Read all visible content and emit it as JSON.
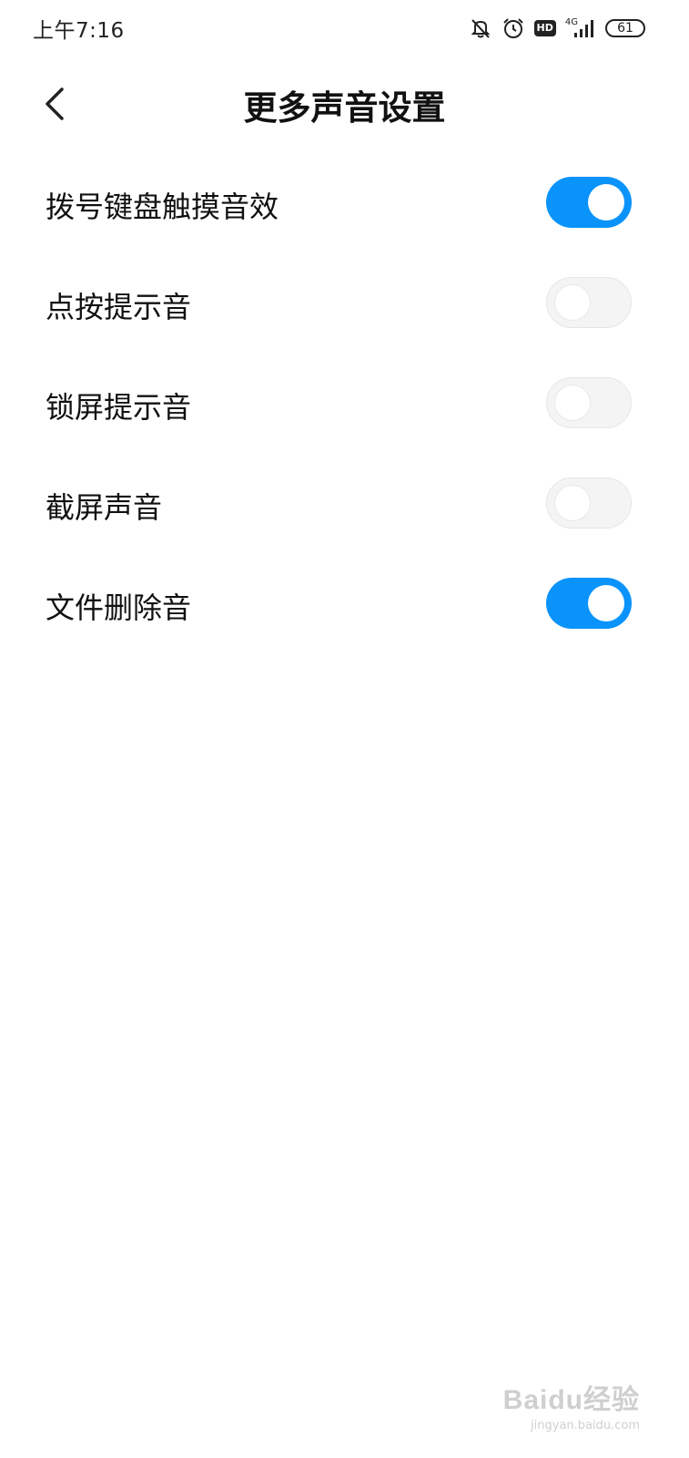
{
  "status_bar": {
    "time": "上午7:16",
    "icons": [
      "mute-icon",
      "alarm-icon",
      "hd-icon",
      "signal-icon",
      "battery-icon"
    ],
    "hd_label": "HD",
    "network_label": "4G",
    "battery_level": "61"
  },
  "header": {
    "title": "更多声音设置",
    "back_icon": "chevron-left-icon"
  },
  "settings": [
    {
      "label": "拨号键盘触摸音效",
      "enabled": true
    },
    {
      "label": "点按提示音",
      "enabled": false
    },
    {
      "label": "锁屏提示音",
      "enabled": false
    },
    {
      "label": "截屏声音",
      "enabled": false
    },
    {
      "label": "文件删除音",
      "enabled": true
    }
  ],
  "colors": {
    "toggle_on": "#0a93fb",
    "toggle_off": "#f4f4f4",
    "background": "#ffffff"
  },
  "watermark": {
    "logo": "Baidu经验",
    "url": "jingyan.baidu.com"
  }
}
